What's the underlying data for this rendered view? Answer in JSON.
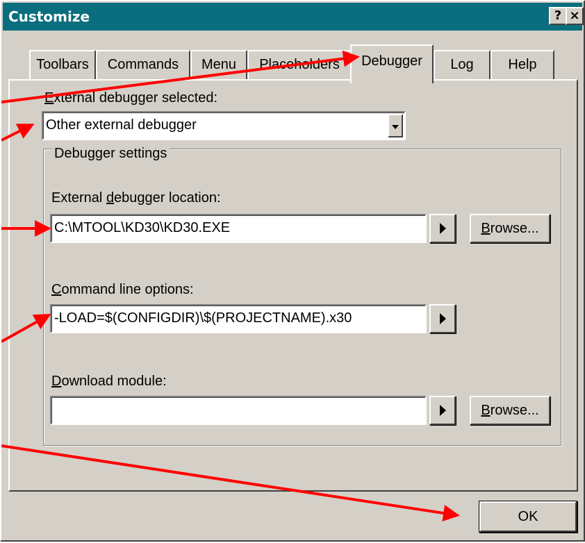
{
  "window": {
    "title": "Customize",
    "help_button": "?",
    "close_button": "×"
  },
  "tabs": [
    {
      "label": "Toolbars",
      "active": false
    },
    {
      "label": "Commands",
      "active": false
    },
    {
      "label": "Menu",
      "active": false
    },
    {
      "label": "Placeholders",
      "active": false
    },
    {
      "label": "Debugger",
      "active": true
    },
    {
      "label": "Log",
      "active": false
    },
    {
      "label": "Help",
      "active": false
    }
  ],
  "debugger": {
    "selector_label_first": "E",
    "selector_label_rest": "xternal debugger selected:",
    "selector_value": "Other external debugger",
    "group_title": "Debugger settings",
    "location_label_pre": "External ",
    "location_label_u": "d",
    "location_label_post": "ebugger location:",
    "location_value": "C:\\MTOOL\\KD30\\KD30.EXE",
    "cmdline_label_first": "C",
    "cmdline_label_rest": "ommand line options:",
    "cmdline_value": "-LOAD=$(CONFIGDIR)\\$(PROJECTNAME).x30",
    "download_label_first": "D",
    "download_label_rest": "ownload module:",
    "download_value": "",
    "browse_first": "B",
    "browse_rest": "rowse..."
  },
  "footer": {
    "ok_label": "OK"
  },
  "colors": {
    "titlebar": "#0a6e7e",
    "dialog_bg": "#d4d0c8",
    "annotation_arrow": "#ff0000"
  },
  "icons": {
    "dropdown": "chevron-down-icon",
    "insert_macro": "arrow-right-icon"
  }
}
